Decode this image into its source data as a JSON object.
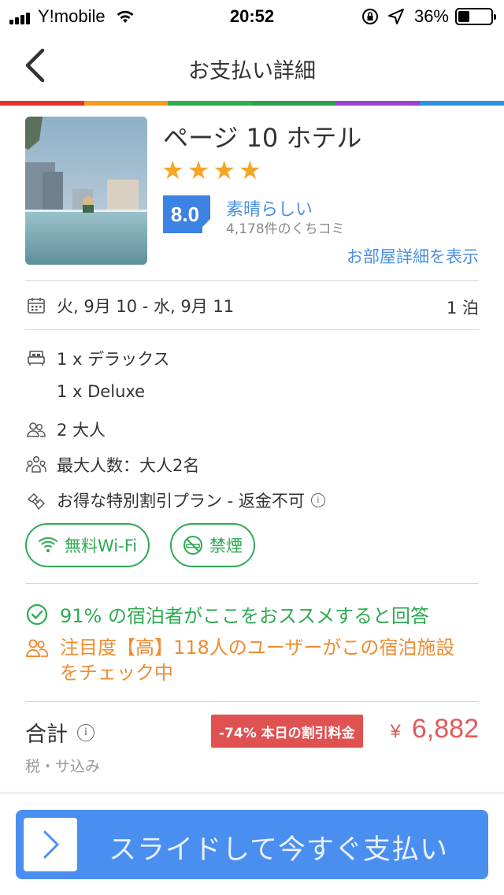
{
  "status_bar": {
    "carrier": "Y!mobile",
    "time": "20:52",
    "battery": "36%",
    "battery_level": 0.36
  },
  "header": {
    "title": "お支払い詳細",
    "accent_colors": [
      "#e8302b",
      "#f39c1e",
      "#2fae4b",
      "#2d9f4a",
      "#9b3fcf",
      "#2f8ee0"
    ]
  },
  "hotel": {
    "name": "ページ 10 ホテル",
    "star_count": 4,
    "score": "8.0",
    "rating_label": "素晴らしい",
    "review_count": "4,178件のくちコミ",
    "room_details_link": "お部屋詳細を表示"
  },
  "stay": {
    "dates": "火, 9月 10 - 水, 9月 11",
    "nights": "1 泊"
  },
  "room": {
    "type_ja": "1 x デラックス",
    "type_en": "1 x Deluxe",
    "guests": "2 大人",
    "max_guests": "最大人数：大人2名",
    "plan": "お得な特別割引プラン - 返金不可"
  },
  "amenities": [
    {
      "label": "無料Wi-Fi",
      "icon": "wifi-icon"
    },
    {
      "label": "禁煙",
      "icon": "no-smoking-icon"
    }
  ],
  "highlights": {
    "recommend": "91% の宿泊者がここをおススメすると回答",
    "popularity": "注目度【高】118人のユーザーがこの宿泊施設をチェック中"
  },
  "total": {
    "label": "合計",
    "tax_note": "税・サ込み",
    "discount_badge": "-74% 本日の割引料金",
    "currency": "¥",
    "amount": "6,882"
  },
  "pay_button": {
    "label": "スライドして今すぐ支払い"
  },
  "colors": {
    "accent_blue": "#4a90e2",
    "success_green": "#2eaa52",
    "warning_orange": "#f08c30",
    "price_red": "#e25a5a",
    "star_orange": "#f5a623"
  }
}
